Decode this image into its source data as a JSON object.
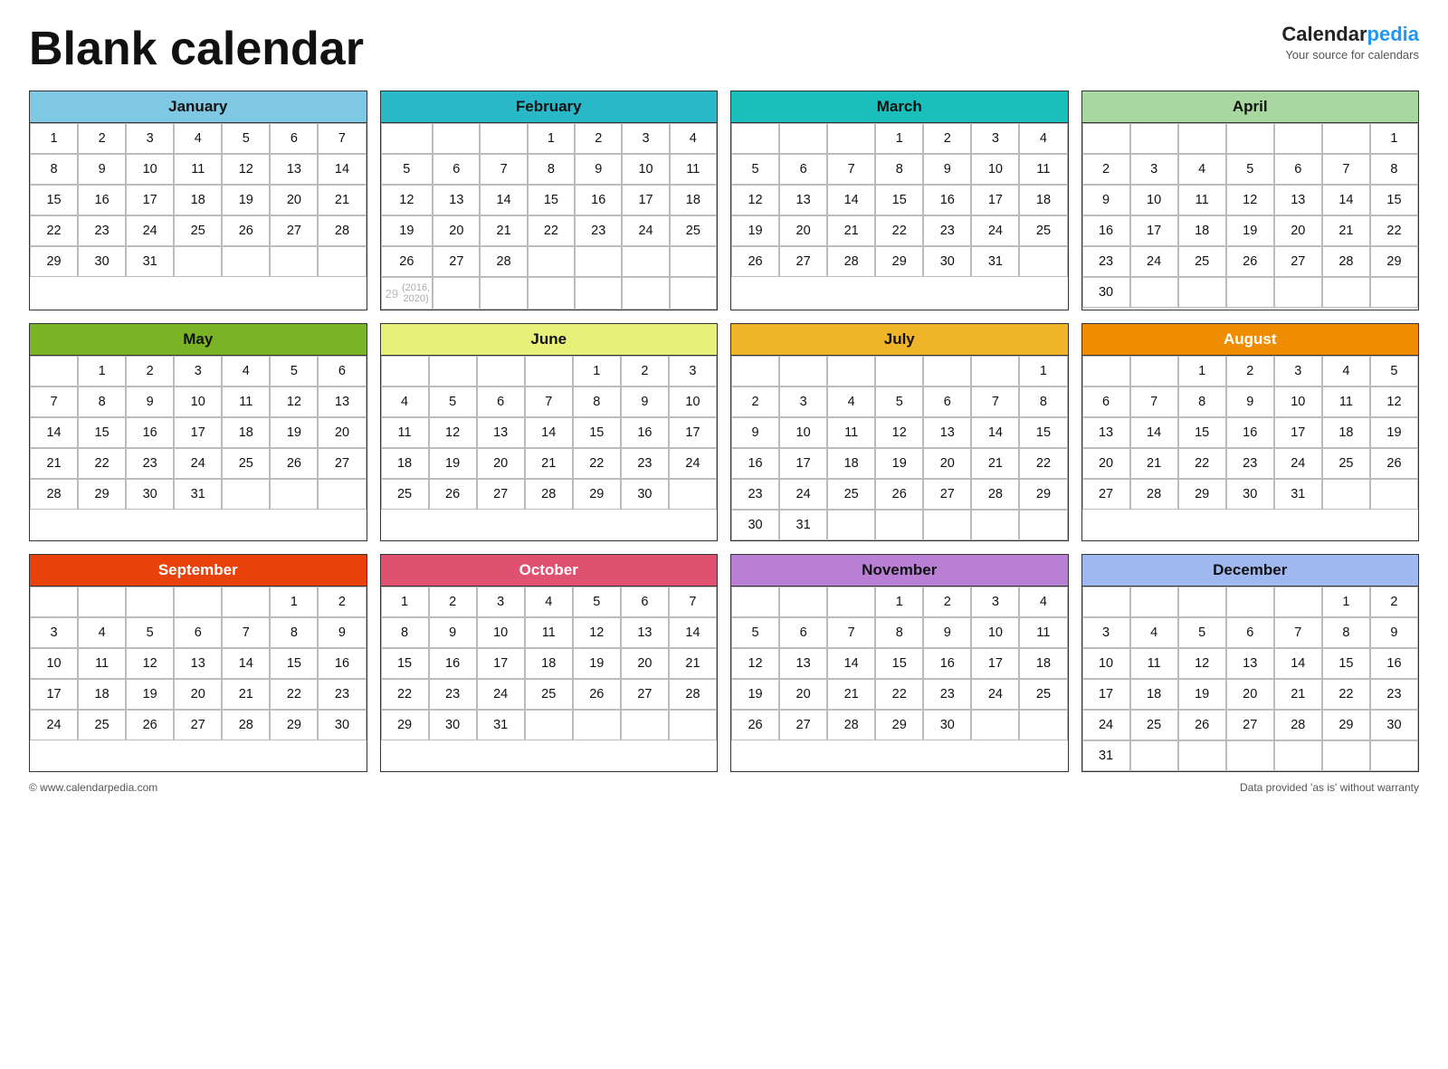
{
  "title": "Blank calendar",
  "brand": {
    "name_calendar": "Calendar",
    "name_pedia": "pedia",
    "tagline": "Your source for calendars"
  },
  "footer": {
    "copyright": "© www.calendarpedia.com",
    "disclaimer": "Data provided 'as is' without warranty"
  },
  "months": [
    {
      "id": "jan",
      "name": "January",
      "colorClass": "jan",
      "days": 31,
      "startDay": 0,
      "leapDay": null
    },
    {
      "id": "feb",
      "name": "February",
      "colorClass": "feb",
      "days": 28,
      "startDay": 3,
      "leapDay": "29",
      "leapNote": "(2016, 2020)"
    },
    {
      "id": "mar",
      "name": "March",
      "colorClass": "mar",
      "days": 31,
      "startDay": 3
    },
    {
      "id": "apr",
      "name": "April",
      "colorClass": "apr",
      "days": 30,
      "startDay": 6
    },
    {
      "id": "may",
      "name": "May",
      "colorClass": "may",
      "days": 31,
      "startDay": 1
    },
    {
      "id": "jun",
      "name": "June",
      "colorClass": "jun",
      "days": 30,
      "startDay": 4
    },
    {
      "id": "jul",
      "name": "July",
      "colorClass": "jul",
      "days": 31,
      "startDay": 6
    },
    {
      "id": "aug",
      "name": "August",
      "colorClass": "aug",
      "days": 31,
      "startDay": 2
    },
    {
      "id": "sep",
      "name": "September",
      "colorClass": "sep",
      "days": 30,
      "startDay": 5
    },
    {
      "id": "oct",
      "name": "October",
      "colorClass": "oct",
      "days": 31,
      "startDay": 0
    },
    {
      "id": "nov",
      "name": "November",
      "colorClass": "nov",
      "days": 30,
      "startDay": 3
    },
    {
      "id": "dec",
      "name": "December",
      "colorClass": "dec",
      "days": 31,
      "startDay": 5
    }
  ]
}
